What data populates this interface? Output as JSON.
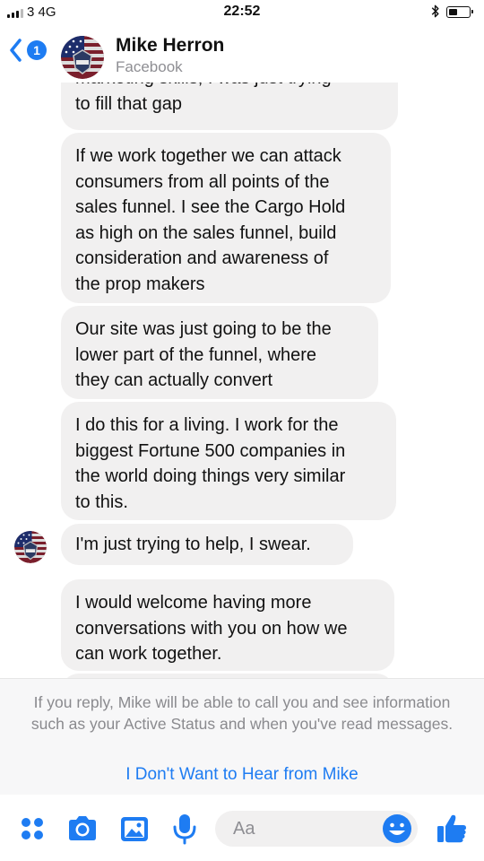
{
  "status_bar": {
    "carrier": "3  4G",
    "time": "22:52"
  },
  "header": {
    "back_badge": "1",
    "contact_name": "Mike Herron",
    "contact_sub": "Facebook"
  },
  "messages": [
    {
      "lines": [
        "marketing skills, I was just trying",
        "to fill that gap"
      ]
    },
    {
      "lines": [
        "If we work together we can attack",
        "consumers from all points of the",
        "sales funnel. I see the Cargo Hold",
        "as high on the sales funnel, build",
        "consideration and awareness of",
        "the prop makers"
      ]
    },
    {
      "lines": [
        "Our site was just going to be the",
        "lower part of the funnel, where",
        "they can actually convert"
      ]
    },
    {
      "lines": [
        "I do this for a living.  I work for the",
        "biggest Fortune 500 companies in",
        "the world doing things very similar",
        "to this."
      ]
    },
    {
      "lines": [
        "I'm just trying to help, I swear."
      ]
    },
    {
      "lines": [
        "I would welcome having more",
        "conversations with you on how we",
        "can work together."
      ]
    }
  ],
  "notice": {
    "text": "If you reply, Mike will be able to call you and see information such as your Active Status and when you've read messages.",
    "link": "I Don't Want to Hear from Mike"
  },
  "composer": {
    "placeholder": "Aa",
    "icons": [
      "more-apps-icon",
      "camera-icon",
      "gallery-icon",
      "microphone-icon",
      "emoji-icon",
      "thumbs-up-icon"
    ]
  },
  "colors": {
    "accent": "#1e7cf2",
    "bubble": "#f1f0f0",
    "notice_bg": "#f7f7f8",
    "notice_text": "#8a8a8e"
  }
}
